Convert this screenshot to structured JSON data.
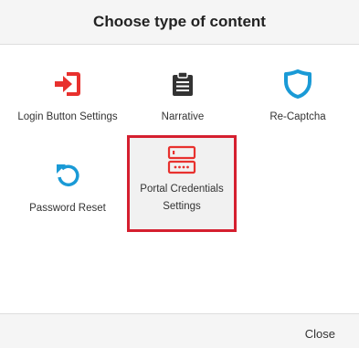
{
  "dialog": {
    "title": "Choose type of content",
    "close_label": "Close"
  },
  "content_types": [
    {
      "label": "Login Button Settings",
      "icon": "login-icon",
      "color": "#e8312e"
    },
    {
      "label": "Narrative",
      "icon": "clipboard-icon",
      "color": "#333333"
    },
    {
      "label": "Re-Captcha",
      "icon": "shield-icon",
      "color": "#1a9ad6"
    },
    {
      "label": "Password Reset",
      "icon": "reset-icon",
      "color": "#1a9ad6"
    },
    {
      "label": "Portal Credentials Settings",
      "icon": "server-icon",
      "color": "#e8312e",
      "selected": true
    }
  ],
  "colors": {
    "selected_border": "#d51f2f",
    "header_bg": "#f5f5f5"
  }
}
